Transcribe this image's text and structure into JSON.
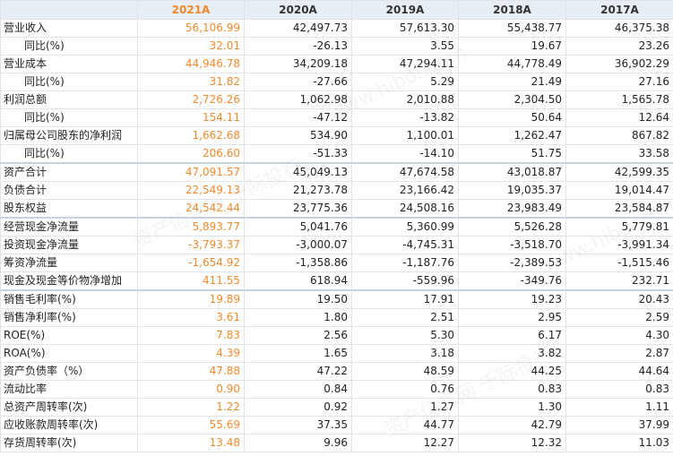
{
  "header": [
    "",
    "2021A",
    "2020A",
    "2019A",
    "2018A",
    "2017A"
  ],
  "accent_color": "#f08a2c",
  "rows": [
    {
      "label": "营业收入",
      "sub": false,
      "values": [
        "56,106.99",
        "42,497.73",
        "57,613.30",
        "55,438.77",
        "46,375.38"
      ]
    },
    {
      "label": "同比(%)",
      "sub": true,
      "values": [
        "32.01",
        "-26.13",
        "3.55",
        "19.67",
        "23.26"
      ]
    },
    {
      "label": "营业成本",
      "sub": false,
      "values": [
        "44,946.78",
        "34,209.18",
        "47,294.11",
        "44,778.49",
        "36,902.29"
      ]
    },
    {
      "label": "同比(%)",
      "sub": true,
      "values": [
        "31.82",
        "-27.66",
        "5.29",
        "21.49",
        "27.16"
      ]
    },
    {
      "label": "利润总额",
      "sub": false,
      "values": [
        "2,726.26",
        "1,062.98",
        "2,010.88",
        "2,304.50",
        "1,565.78"
      ]
    },
    {
      "label": "同比(%)",
      "sub": true,
      "values": [
        "154.11",
        "-47.12",
        "-13.82",
        "50.64",
        "12.64"
      ]
    },
    {
      "label": "归属母公司股东的净利润",
      "sub": false,
      "values": [
        "1,662.68",
        "534.90",
        "1,100.01",
        "1,262.47",
        "867.82"
      ]
    },
    {
      "label": "同比(%)",
      "sub": true,
      "values": [
        "206.60",
        "-51.33",
        "-14.10",
        "51.75",
        "33.58"
      ]
    },
    {
      "label": "资产合计",
      "sub": false,
      "gap": true,
      "values": [
        "47,091.57",
        "45,049.13",
        "47,674.58",
        "43,018.87",
        "42,599.35"
      ]
    },
    {
      "label": "负债合计",
      "sub": false,
      "values": [
        "22,549.13",
        "21,273.78",
        "23,166.42",
        "19,035.37",
        "19,014.47"
      ]
    },
    {
      "label": "股东权益",
      "sub": false,
      "values": [
        "24,542.44",
        "23,775.36",
        "24,508.16",
        "23,983.49",
        "23,584.87"
      ]
    },
    {
      "label": "经营现金净流量",
      "sub": false,
      "gap": true,
      "values": [
        "5,893.77",
        "5,041.76",
        "5,360.99",
        "5,526.28",
        "5,779.81"
      ]
    },
    {
      "label": "投资现金净流量",
      "sub": false,
      "values": [
        "-3,793.37",
        "-3,000.07",
        "-4,745.31",
        "-3,518.70",
        "-3,991.34"
      ]
    },
    {
      "label": "筹资净流量",
      "sub": false,
      "values": [
        "-1,654.92",
        "-1,358.86",
        "-1,187.76",
        "-2,389.53",
        "-1,515.46"
      ]
    },
    {
      "label": "现金及现金等价物净增加",
      "sub": false,
      "values": [
        "411.55",
        "618.94",
        "-559.96",
        "-349.76",
        "232.71"
      ]
    },
    {
      "label": "销售毛利率(%)",
      "sub": false,
      "gap": true,
      "values": [
        "19.89",
        "19.50",
        "17.91",
        "19.23",
        "20.43"
      ]
    },
    {
      "label": "销售净利率(%)",
      "sub": false,
      "values": [
        "3.61",
        "1.80",
        "2.51",
        "2.95",
        "2.59"
      ]
    },
    {
      "label": "ROE(%)",
      "sub": false,
      "values": [
        "7.83",
        "2.56",
        "5.30",
        "6.17",
        "4.30"
      ]
    },
    {
      "label": "ROA(%)",
      "sub": false,
      "values": [
        "4.39",
        "1.65",
        "3.18",
        "3.82",
        "2.87"
      ]
    },
    {
      "label": "资产负债率（%）",
      "sub": false,
      "values": [
        "47.88",
        "47.22",
        "48.59",
        "44.25",
        "44.64"
      ]
    },
    {
      "label": "流动比率",
      "sub": false,
      "values": [
        "0.90",
        "0.84",
        "0.76",
        "0.83",
        "0.83"
      ]
    },
    {
      "label": "总资产周转率(次)",
      "sub": false,
      "values": [
        "1.22",
        "0.92",
        "1.27",
        "1.30",
        "1.11"
      ]
    },
    {
      "label": "应收账款周转率(次)",
      "sub": false,
      "values": [
        "55.69",
        "37.35",
        "44.77",
        "42.79",
        "37.99"
      ]
    },
    {
      "label": "存货周转率(次)",
      "sub": false,
      "values": [
        "13.48",
        "9.96",
        "12.27",
        "12.32",
        "11.03"
      ]
    }
  ],
  "watermark": [
    "资产信息网 千际投行",
    "www.hibor.com"
  ]
}
